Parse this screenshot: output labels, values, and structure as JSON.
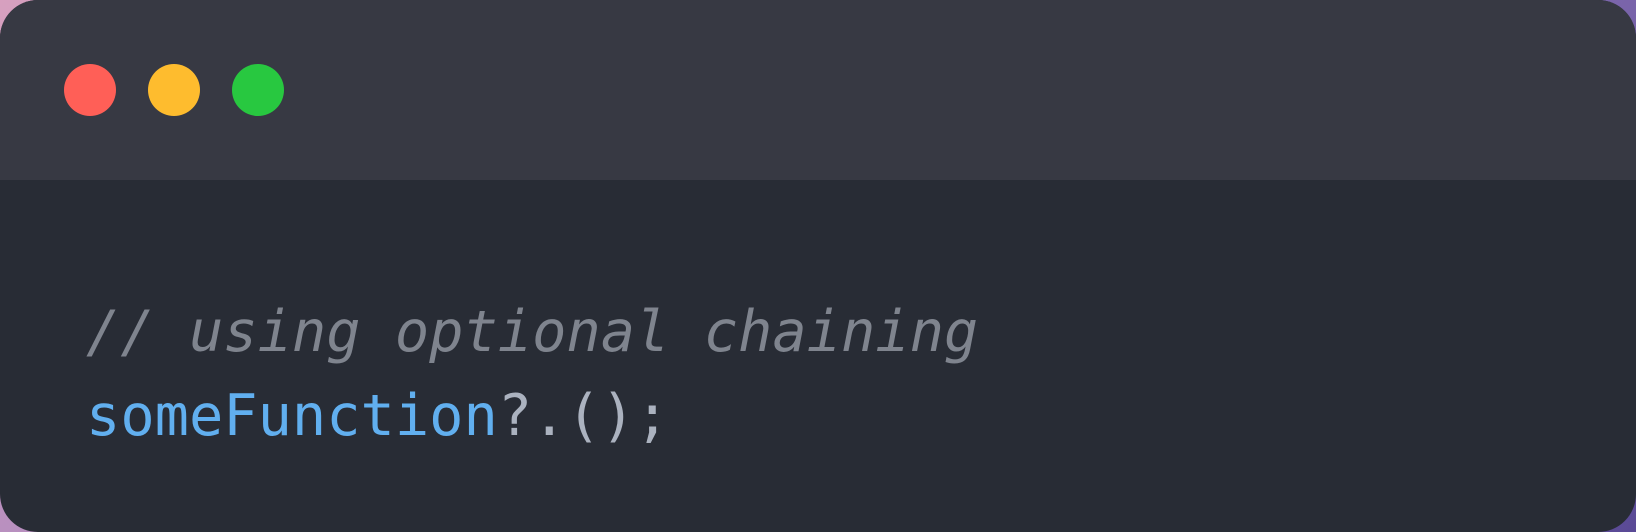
{
  "colors": {
    "background_gradient": [
      "#d7a0bf",
      "#9a7fbf",
      "#5a4a96"
    ],
    "window_bg": "#282c35",
    "titlebar_bg": "#373943",
    "close": "#ff5f57",
    "minimize": "#febc2e",
    "zoom": "#28c840",
    "comment": "#7f848e",
    "function": "#61afef",
    "punctuation": "#abb2bf"
  },
  "window_controls": [
    {
      "name": "close",
      "icon": "close-dot-icon"
    },
    {
      "name": "minimize",
      "icon": "minimize-dot-icon"
    },
    {
      "name": "zoom",
      "icon": "zoom-dot-icon"
    }
  ],
  "code": {
    "lines": [
      {
        "tokens": [
          {
            "type": "comment",
            "text": "// using optional chaining"
          }
        ]
      },
      {
        "tokens": [
          {
            "type": "function",
            "text": "someFunction"
          },
          {
            "type": "punctuation",
            "text": "?.();"
          }
        ]
      }
    ]
  }
}
